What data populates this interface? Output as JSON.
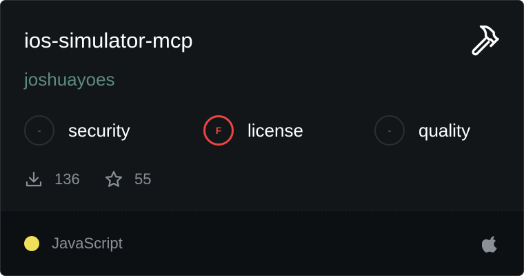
{
  "card": {
    "title": "ios-simulator-mcp",
    "author": "joshuayoes",
    "tool_icon": "hammer-icon"
  },
  "scores": [
    {
      "label": "security",
      "grade": "-",
      "status": "none"
    },
    {
      "label": "license",
      "grade": "F",
      "status": "fail"
    },
    {
      "label": "quality",
      "grade": "-",
      "status": "none"
    }
  ],
  "stats": {
    "downloads": "136",
    "stars": "55"
  },
  "footer": {
    "language": "JavaScript",
    "language_color": "#f1e05a",
    "platform_icon": "apple-icon"
  },
  "colors": {
    "background": "#121619",
    "fail": "#ef4444",
    "author": "#5e8a7f"
  }
}
